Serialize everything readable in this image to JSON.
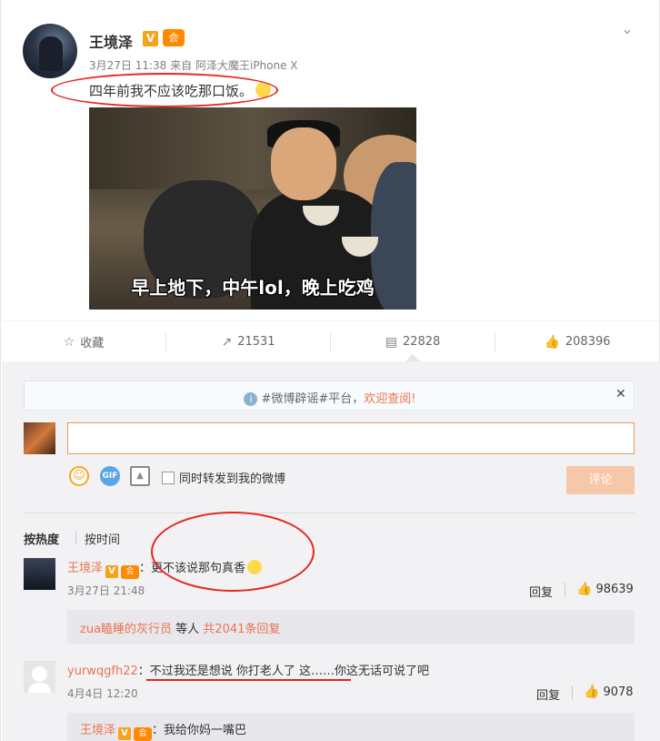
{
  "post": {
    "author": "王境泽",
    "verified_badge": "V",
    "member_badge": "会",
    "meta_time": "3月27日 11:38",
    "meta_from": "来自",
    "meta_device": "阿泽大魔王iPhone X",
    "text": "四年前我不应该吃那口饭。",
    "image_caption": "早上地下，中午lol，晚上吃鸡"
  },
  "actions": {
    "favorite": "收藏",
    "repost_count": "21531",
    "comment_count": "22828",
    "like_count": "208396"
  },
  "notice": {
    "tag_text": "#微博辟谣#平台，",
    "highlight": "欢迎查阅!"
  },
  "composer": {
    "repost_checkbox_label": "同时转发到我的微博",
    "submit_label": "评论"
  },
  "sort": {
    "hot": "按热度",
    "time": "按时间"
  },
  "comments": [
    {
      "author": "王境泽",
      "text": "：更不该说那句真香",
      "date": "3月27日 21:48",
      "reply_label": "回复",
      "likes": "98639",
      "sub_author": "zua瞌睡的灰行员",
      "sub_mid": " 等人 ",
      "sub_link": "共2041条回复"
    },
    {
      "author": "yurwqgfh22",
      "text": "：不过我还是想说  你打老人了  这……你这无话可说了吧",
      "date": "4月4日 12:20",
      "reply_label": "回复",
      "likes": "9078",
      "sub_author": "王境泽",
      "sub_text": "：我给你妈一嘴巴"
    }
  ],
  "colors": {
    "accent": "#eb7350",
    "annotation_red": "#e8241d",
    "verified_orange": "#f7a21b"
  }
}
